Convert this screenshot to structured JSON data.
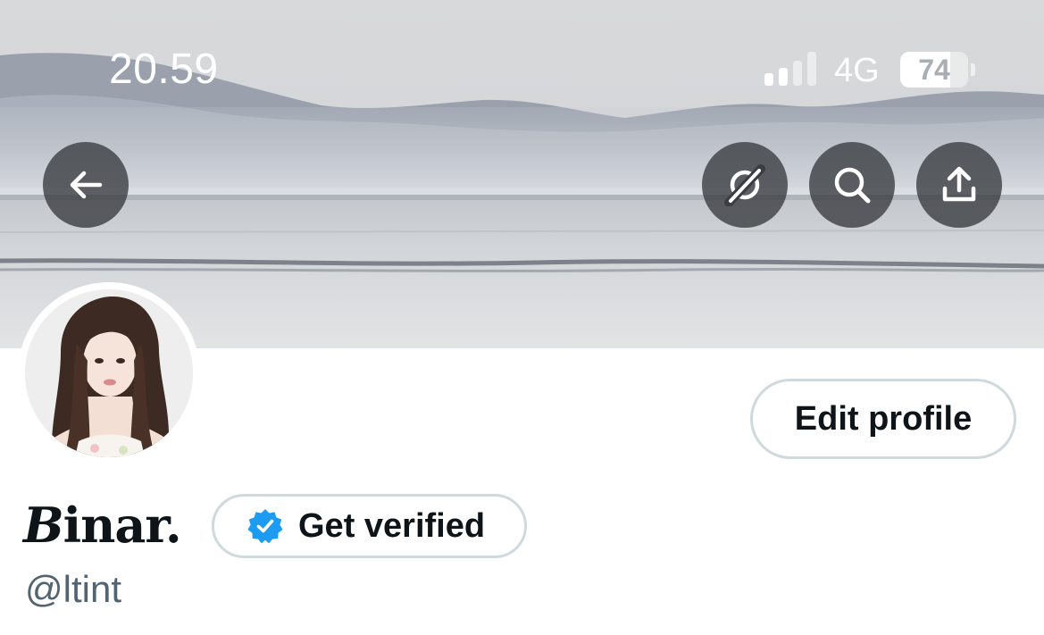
{
  "status_bar": {
    "time": "20.59",
    "network": "4G",
    "battery": "74",
    "signal_bars_active": 2,
    "signal_bars_total": 4
  },
  "top_actions": {
    "back_icon": "arrow-left-icon",
    "grok_icon": "grok-slash-icon",
    "search_icon": "search-icon",
    "share_icon": "share-upload-icon",
    "button_color": "#3a3d41"
  },
  "profile": {
    "display_name_first": "B",
    "display_name_rest": "inar.",
    "handle": "@ltint",
    "edit_label": "Edit profile",
    "verify_label": "Get verified",
    "verified_badge_color": "#1d9bf0"
  }
}
